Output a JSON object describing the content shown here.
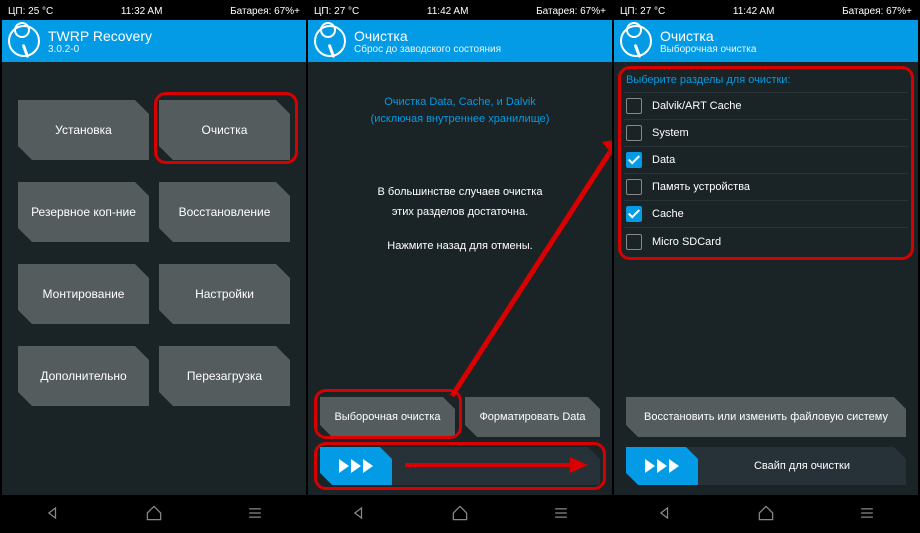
{
  "screens": [
    {
      "status": {
        "cpu": "ЦП: 25 °C",
        "time": "11:32 AM",
        "battery": "Батарея: 67%+"
      },
      "header": {
        "title": "TWRP Recovery",
        "sub": "3.0.2-0"
      },
      "tiles": [
        "Установка",
        "Очистка",
        "Резервное коп-ние",
        "Восстановление",
        "Монтирование",
        "Настройки",
        "Дополнительно",
        "Перезагрузка"
      ]
    },
    {
      "status": {
        "cpu": "ЦП: 27 °C",
        "time": "11:42 AM",
        "battery": "Батарея: 67%+"
      },
      "header": {
        "title": "Очистка",
        "sub": "Сброс до заводского состояния"
      },
      "info1": "Очистка Data, Cache, и Dalvik",
      "info2": "(исключая внутреннее хранилище)",
      "desc1": "В большинстве случаев очистка",
      "desc2": "этих разделов достаточна.",
      "desc3": "Нажмите назад для отмены.",
      "btn1": "Выборочная очистка",
      "btn2": "Форматировать Data"
    },
    {
      "status": {
        "cpu": "ЦП: 27 °C",
        "time": "11:42 AM",
        "battery": "Батарея: 67%+"
      },
      "header": {
        "title": "Очистка",
        "sub": "Выборочная очистка"
      },
      "listTitle": "Выберите разделы для очистки:",
      "items": [
        {
          "label": "Dalvik/ART Cache",
          "checked": false
        },
        {
          "label": "System",
          "checked": false
        },
        {
          "label": "Data",
          "checked": true
        },
        {
          "label": "Память устройства",
          "checked": false
        },
        {
          "label": "Cache",
          "checked": true
        },
        {
          "label": "Micro SDCard",
          "checked": false
        }
      ],
      "wideBtn": "Восстановить или изменить файловую систему",
      "slider": "Свайп для очистки"
    }
  ]
}
